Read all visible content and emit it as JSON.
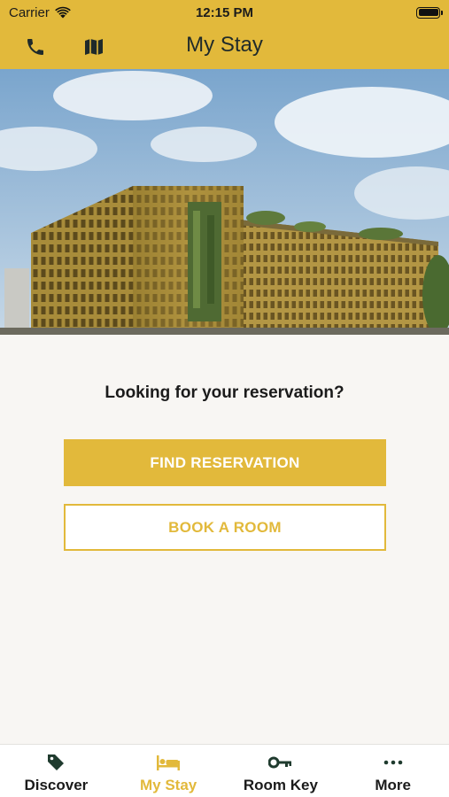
{
  "status_bar": {
    "carrier": "Carrier",
    "time": "12:15 PM"
  },
  "header": {
    "title": "My Stay",
    "phone_icon": "phone-icon",
    "map_icon": "map-icon"
  },
  "hero": {
    "image": "hotel-building-photo"
  },
  "main": {
    "prompt": "Looking for your reservation?",
    "find_reservation_label": "FIND RESERVATION",
    "book_room_label": "BOOK A ROOM"
  },
  "tab_bar": {
    "items": [
      {
        "label": "Discover",
        "icon": "tag-icon",
        "active": false
      },
      {
        "label": "My Stay",
        "icon": "bed-icon",
        "active": true
      },
      {
        "label": "Room Key",
        "icon": "key-icon",
        "active": false
      },
      {
        "label": "More",
        "icon": "more-icon",
        "active": false
      }
    ]
  },
  "colors": {
    "accent": "#e2b93b",
    "background": "#f8f6f3",
    "text": "#1b1b1b"
  }
}
